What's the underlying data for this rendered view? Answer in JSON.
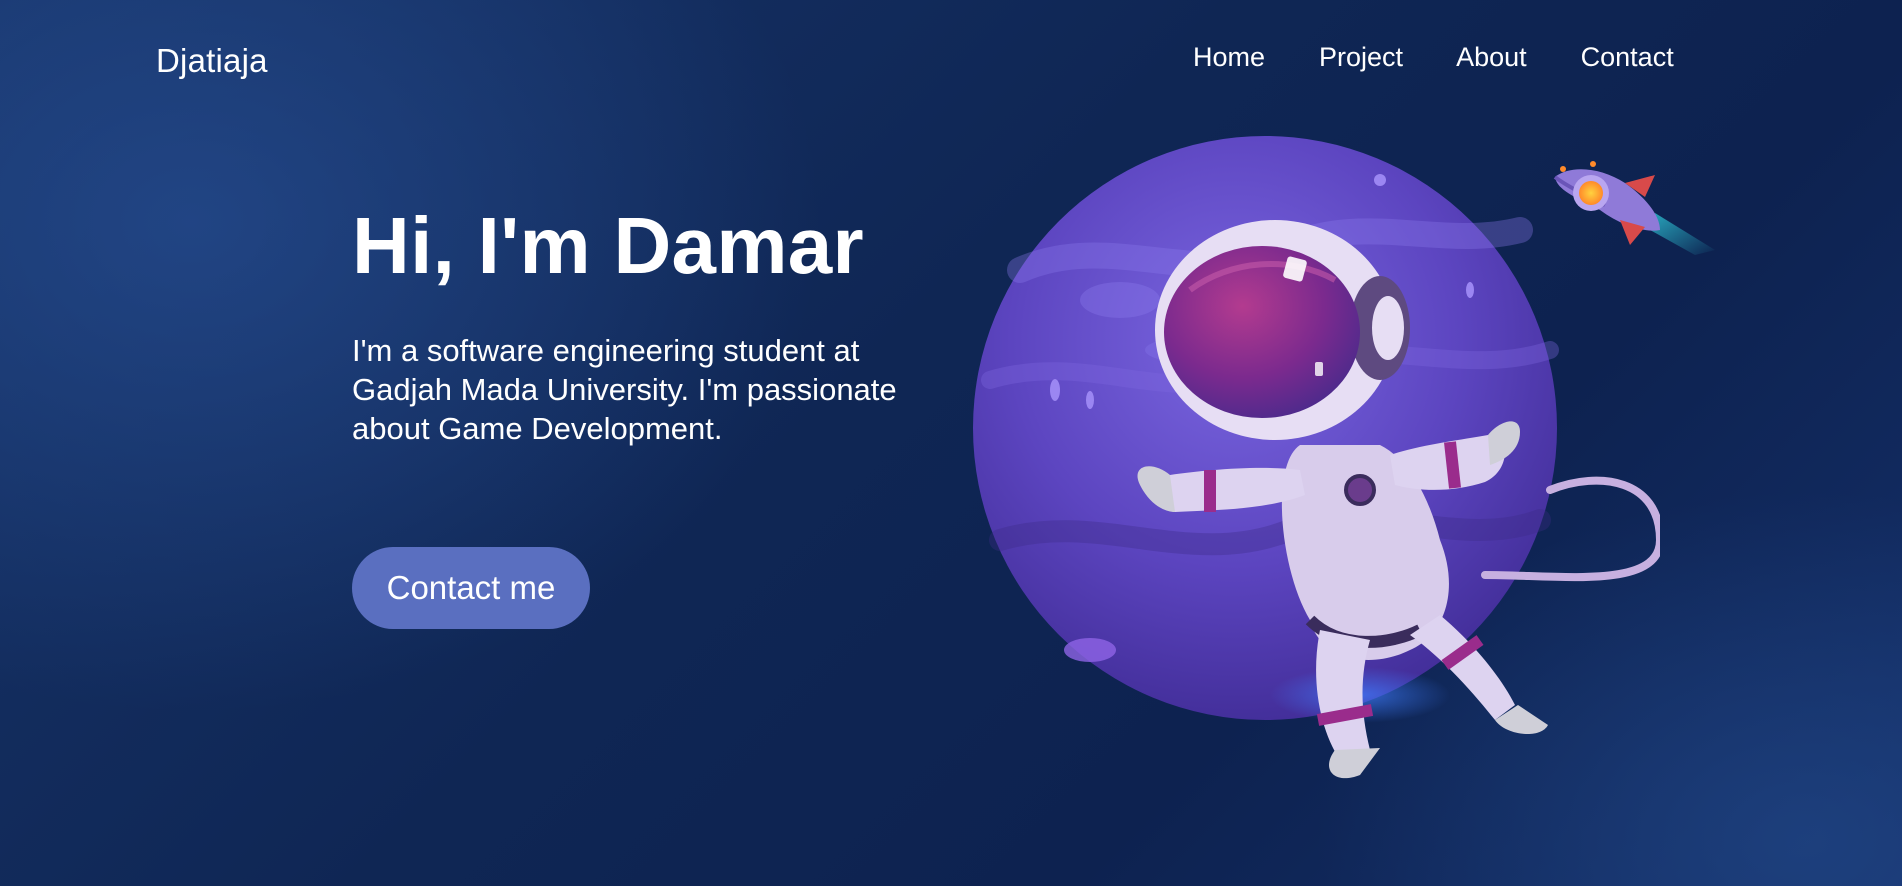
{
  "header": {
    "logo": "Djatiaja",
    "nav": [
      {
        "label": "Home"
      },
      {
        "label": "Project"
      },
      {
        "label": "About"
      },
      {
        "label": "Contact"
      }
    ]
  },
  "hero": {
    "title": "Hi, I'm Damar",
    "description": "I'm a software engineering student at Gadjah Mada University. I'm passionate about Game Development.",
    "cta_label": "Contact me"
  },
  "illustration": {
    "planet_icon": "planet-icon",
    "astronaut_icon": "astronaut-icon",
    "rocket_icon": "rocket-icon"
  },
  "colors": {
    "background": "#0f2654",
    "button": "#5a6fc0",
    "planet": "#6a4fc8",
    "text": "#ffffff"
  }
}
